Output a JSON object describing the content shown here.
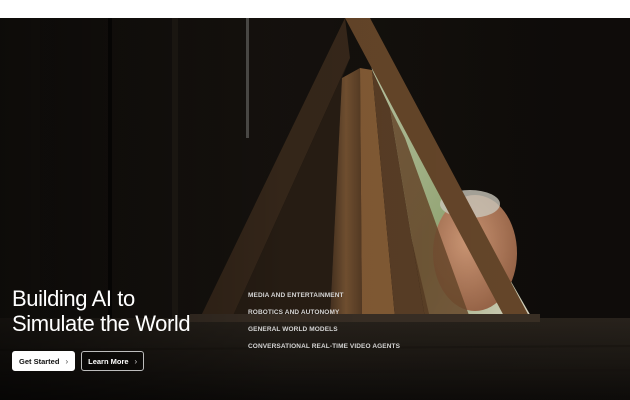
{
  "hero": {
    "headline_line1": "Building AI to",
    "headline_line2": "Simulate the World",
    "primary_cta": "Get Started",
    "secondary_cta": "Learn More",
    "chevron": "›"
  },
  "verticals": [
    "MEDIA AND ENTERTAINMENT",
    "ROBOTICS AND AUTONOMY",
    "GENERAL WORLD MODELS",
    "CONVERSATIONAL REAL-TIME VIDEO AGENTS"
  ]
}
